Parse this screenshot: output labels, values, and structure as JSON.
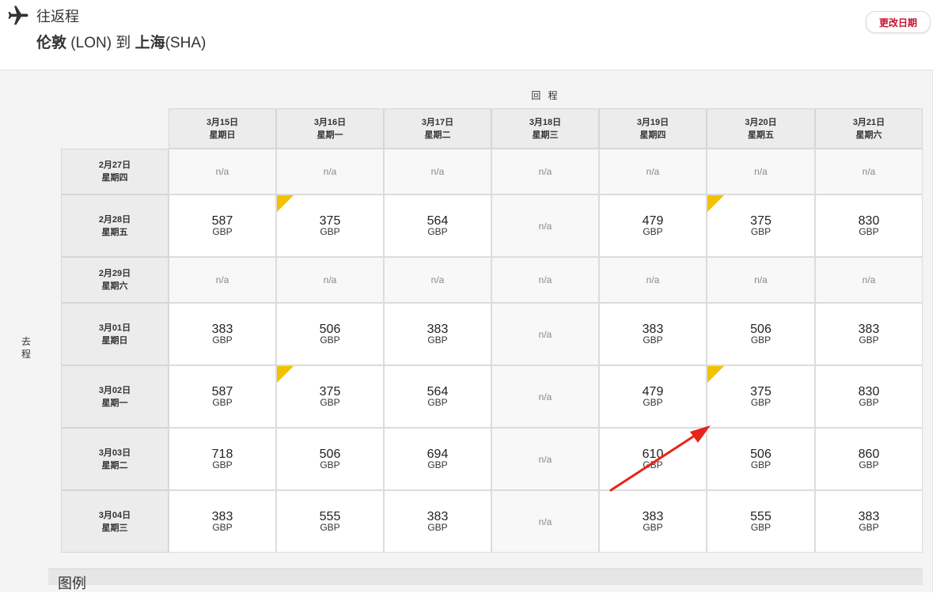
{
  "header": {
    "icon": "airplane-icon",
    "trip_type": "往返程",
    "route": {
      "from_city": "伦敦",
      "from_code": " (LON) ",
      "to_word": "到 ",
      "to_city": "上海",
      "to_code": "(SHA)"
    },
    "change_date_label": "更改日期"
  },
  "matrix": {
    "return_label": "回 程",
    "depart_label": [
      "去",
      "程"
    ],
    "return_dates": [
      {
        "date": "3月15日",
        "weekday": "星期日"
      },
      {
        "date": "3月16日",
        "weekday": "星期一"
      },
      {
        "date": "3月17日",
        "weekday": "星期二"
      },
      {
        "date": "3月18日",
        "weekday": "星期三"
      },
      {
        "date": "3月19日",
        "weekday": "星期四"
      },
      {
        "date": "3月20日",
        "weekday": "星期五"
      },
      {
        "date": "3月21日",
        "weekday": "星期六"
      }
    ],
    "currency": "GBP",
    "na_text": "n/a",
    "rows": [
      {
        "date": "2月27日",
        "weekday": "星期四",
        "prices": [
          null,
          null,
          null,
          null,
          null,
          null,
          null
        ],
        "cheapest": []
      },
      {
        "date": "2月28日",
        "weekday": "星期五",
        "prices": [
          "587",
          "375",
          "564",
          null,
          "479",
          "375",
          "830"
        ],
        "cheapest": [
          1,
          5
        ]
      },
      {
        "date": "2月29日",
        "weekday": "星期六",
        "prices": [
          null,
          null,
          null,
          null,
          null,
          null,
          null
        ],
        "cheapest": []
      },
      {
        "date": "3月01日",
        "weekday": "星期日",
        "prices": [
          "383",
          "506",
          "383",
          null,
          "383",
          "506",
          "383"
        ],
        "cheapest": []
      },
      {
        "date": "3月02日",
        "weekday": "星期一",
        "prices": [
          "587",
          "375",
          "564",
          null,
          "479",
          "375",
          "830"
        ],
        "cheapest": [
          1,
          5
        ]
      },
      {
        "date": "3月03日",
        "weekday": "星期二",
        "prices": [
          "718",
          "506",
          "694",
          null,
          "610",
          "506",
          "860"
        ],
        "cheapest": []
      },
      {
        "date": "3月04日",
        "weekday": "星期三",
        "prices": [
          "383",
          "555",
          "383",
          null,
          "383",
          "555",
          "383"
        ],
        "cheapest": []
      }
    ]
  },
  "legend": {
    "title": "图例"
  },
  "colors": {
    "brand_red": "#c8102e",
    "cheapest_flag": "#f2c200",
    "annotation_arrow": "#e8231a"
  }
}
